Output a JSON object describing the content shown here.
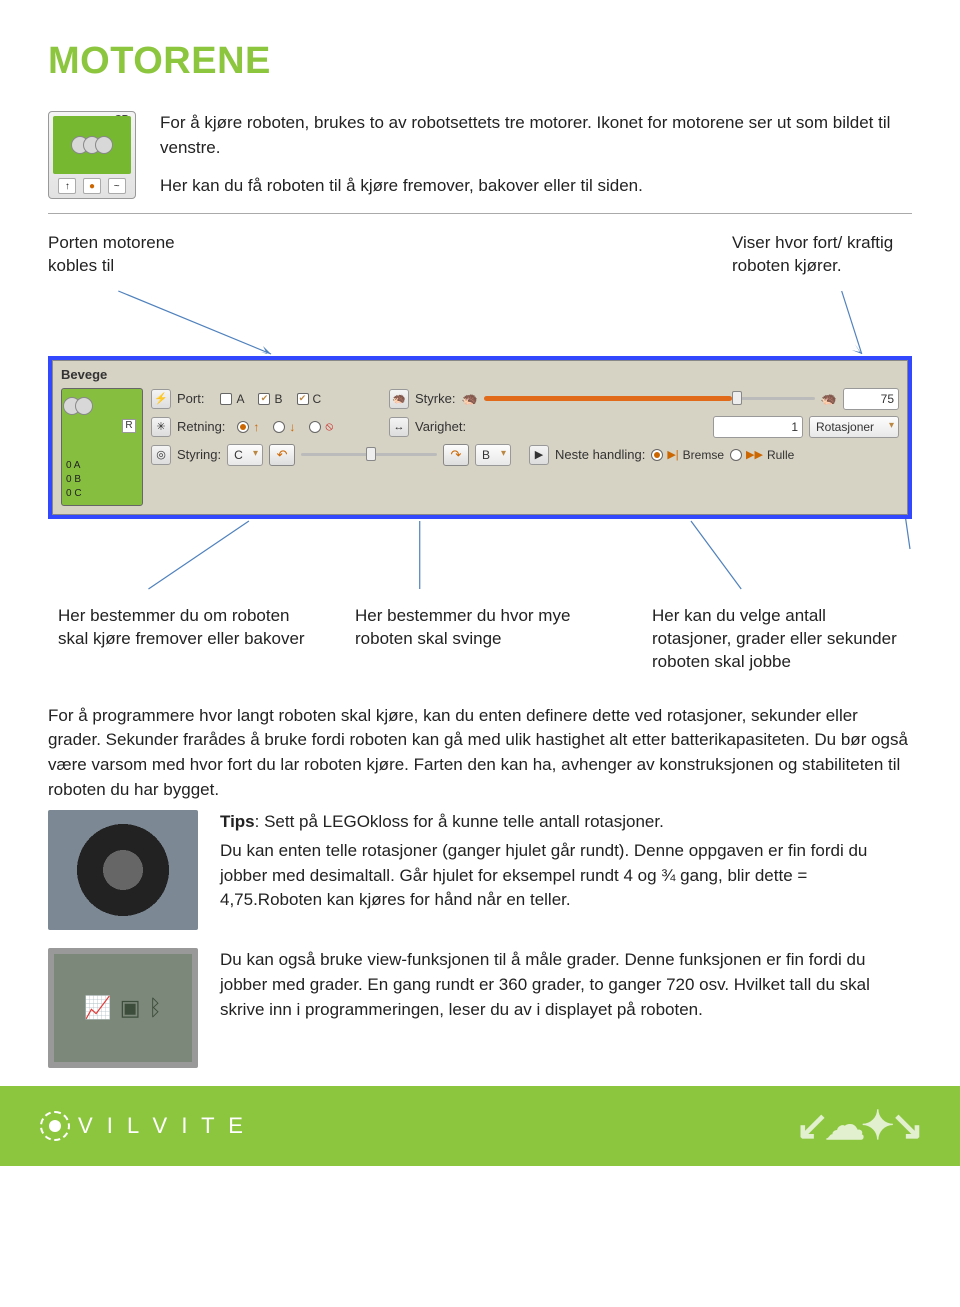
{
  "title": "MOTORENE",
  "intro": {
    "p1": "For å kjøre roboten, brukes to av robotsettets tre motorer. Ikonet for motorene ser ut som bildet til venstre.",
    "p2": "Her kan du få roboten til å kjøre fremover, bakover eller til siden."
  },
  "motor_icon": {
    "corner_label": "CB",
    "bottom_icons": [
      "↑",
      "●",
      "~"
    ]
  },
  "callouts_top": {
    "left": "Porten motorene kobles til",
    "right": "Viser hvor fort/ kraftig  roboten kjører."
  },
  "panel": {
    "name": "Bevege",
    "rows": {
      "port": {
        "label": "Port:",
        "options": [
          {
            "label": "A",
            "checked": false
          },
          {
            "label": "B",
            "checked": true
          },
          {
            "label": "C",
            "checked": true
          }
        ]
      },
      "styrke": {
        "label": "Styrke:",
        "value": "75",
        "fill_pct": 75
      },
      "retning": {
        "label": "Retning:",
        "selected_index": 0,
        "options": [
          "↑",
          "↓",
          "⦸"
        ]
      },
      "varighet": {
        "label": "Varighet:",
        "value": "1",
        "unit": "Rotasjoner"
      },
      "styring": {
        "label": "Styring:",
        "left_port": "C",
        "right_port": "B",
        "thumb_pct": 50
      },
      "neste": {
        "label": "Neste handling:",
        "options": [
          {
            "label": "Bremse",
            "icon": "▶|",
            "selected": true
          },
          {
            "label": "Rulle",
            "icon": "▶▶",
            "selected": false
          }
        ]
      }
    },
    "side": {
      "r_label": "R",
      "ports": [
        "0  A",
        "0  B",
        "0  C"
      ]
    }
  },
  "callouts_bottom": {
    "left": "Her bestemmer du om roboten skal kjøre fremover eller bakover",
    "mid": "Her bestemmer du hvor mye roboten skal svinge",
    "right": "Her kan du velge antall rotasjoner, grader eller sekunder roboten skal jobbe"
  },
  "body_paragraph": "For å programmere hvor langt roboten skal kjøre, kan du enten definere dette ved rotasjoner, sekunder eller grader. Sekunder frarådes å bruke fordi roboten kan gå med ulik hastighet alt etter batterikapasiteten. Du bør også være varsom med hvor fort du lar roboten kjøre. Farten den kan ha, avhenger av konstruksjonen og stabiliteten til roboten du har bygget.",
  "tips1": {
    "label": "Tips",
    "line1": ": Sett på LEGOkloss for å kunne telle antall rotasjoner.",
    "p2": "Du kan enten telle rotasjoner (ganger hjulet går rundt). Denne oppgaven er fin fordi du jobber med desimaltall. Går hjulet for eksempel rundt 4 og ¾ gang, blir dette = 4,75.Roboten kan kjøres for hånd når en teller."
  },
  "tips2": {
    "p": "Du kan også bruke view-funksjonen til å måle grader. Denne funksjonen er fin fordi du jobber med grader. En gang rundt er 360 grader, to ganger 720 osv. Hvilket tall du skal skrive inn i programmeringen, leser du av i displayet på roboten."
  },
  "footer_logo": "V I L V I T E"
}
